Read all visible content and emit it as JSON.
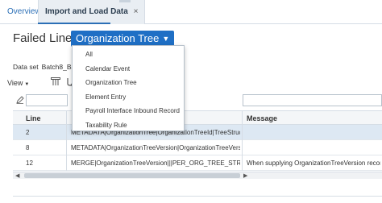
{
  "tabs": {
    "overview": "Overview",
    "active": "Import and Load Data",
    "close_glyph": "×"
  },
  "heading": {
    "label": "Failed Lines:",
    "selected": "Organization Tree"
  },
  "dropdown": {
    "options": [
      "All",
      "Calendar Event",
      "Organization Tree",
      "Element Entry",
      "Payroll Interface Inbound Record",
      "Taxability Rule"
    ]
  },
  "dataset": {
    "label": "Data set",
    "value": "Batch8_BJZ"
  },
  "toolbar": {
    "view_label": "View"
  },
  "table": {
    "columns": {
      "line": "Line",
      "message": "Message"
    },
    "rows": [
      {
        "line": "2",
        "data": "METADATA|OrganizationTree|OrganizationTreeId|TreeStructureCo",
        "message": ""
      },
      {
        "line": "8",
        "data": "METADATA|OrganizationTreeVersion|OrganizationTreeVersionId|O",
        "message": ""
      },
      {
        "line": "12",
        "data": "MERGE|OrganizationTreeVersion|||PER_ORG_TREE_STRUCTU",
        "message": "When supplying OrganizationTreeVersion records"
      }
    ]
  },
  "colors": {
    "accent": "#1f6fc5",
    "selected_row": "#dde8f3",
    "link": "#2b6fb6"
  }
}
